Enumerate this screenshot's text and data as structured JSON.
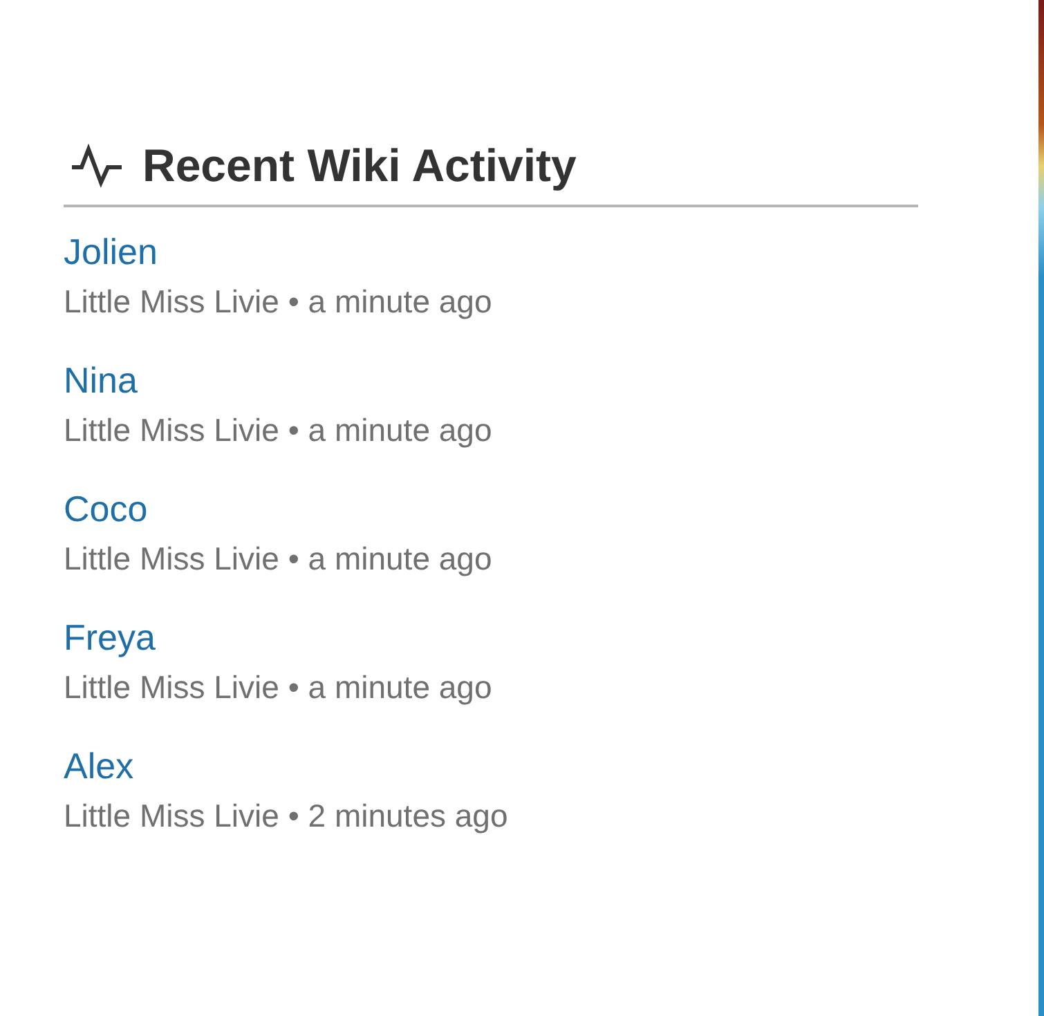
{
  "module": {
    "title": "Recent Wiki Activity"
  },
  "activity": [
    {
      "page": "Jolien",
      "meta": "Little Miss Livie • a minute ago"
    },
    {
      "page": "Nina",
      "meta": "Little Miss Livie • a minute ago"
    },
    {
      "page": "Coco",
      "meta": "Little Miss Livie • a minute ago"
    },
    {
      "page": "Freya",
      "meta": "Little Miss Livie • a minute ago"
    },
    {
      "page": "Alex",
      "meta": "Little Miss Livie • 2 minutes ago"
    }
  ]
}
